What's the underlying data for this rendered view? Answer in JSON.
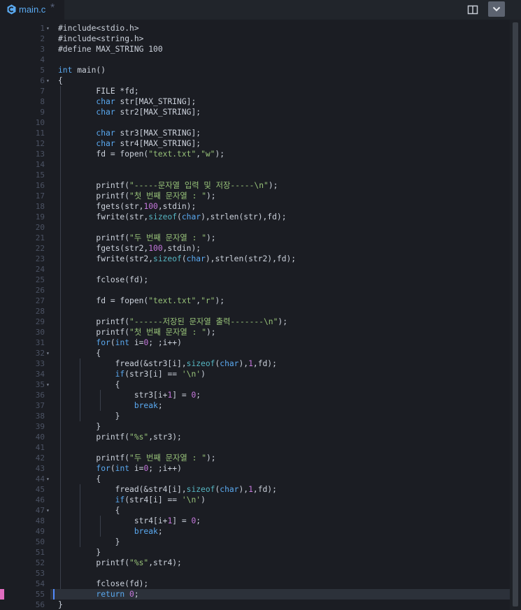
{
  "tab": {
    "filename": "main.c",
    "modified": "*",
    "icon": "c-file-icon"
  },
  "toolbar": {
    "split_icon": "split-view-icon",
    "menu_icon": "chevron-down-icon"
  },
  "editor": {
    "current_line": 55,
    "fold_lines": [
      1,
      6,
      32,
      35,
      44,
      47
    ],
    "lines": [
      [
        [
          "#include<stdio.h>",
          ""
        ]
      ],
      [
        [
          "#include<string.h>",
          ""
        ]
      ],
      [
        [
          "#define MAX_STRING 100",
          ""
        ]
      ],
      [],
      [
        [
          "int",
          "kw"
        ],
        [
          " main()",
          ""
        ]
      ],
      [
        [
          "{",
          ""
        ]
      ],
      [
        [
          "        FILE *fd;",
          ""
        ]
      ],
      [
        [
          "        ",
          ""
        ],
        [
          "char",
          "kw"
        ],
        [
          " str[MAX_STRING];",
          ""
        ]
      ],
      [
        [
          "        ",
          ""
        ],
        [
          "char",
          "kw"
        ],
        [
          " str2[MAX_STRING];",
          ""
        ]
      ],
      [],
      [
        [
          "        ",
          ""
        ],
        [
          "char",
          "kw"
        ],
        [
          " str3[MAX_STRING];",
          ""
        ]
      ],
      [
        [
          "        ",
          ""
        ],
        [
          "char",
          "kw"
        ],
        [
          " str4[MAX_STRING];",
          ""
        ]
      ],
      [
        [
          "        fd = fopen(",
          ""
        ],
        [
          "\"text.txt\"",
          "str"
        ],
        [
          ",",
          ""
        ],
        [
          "\"w\"",
          "str"
        ],
        [
          ");",
          ""
        ]
      ],
      [],
      [],
      [
        [
          "        printf(",
          ""
        ],
        [
          "\"-----문자열 입력 및 저장-----\\n\"",
          "str"
        ],
        [
          ");",
          ""
        ]
      ],
      [
        [
          "        printf(",
          ""
        ],
        [
          "\"첫 번째 문자열 : \"",
          "str"
        ],
        [
          ");",
          ""
        ]
      ],
      [
        [
          "        fgets(str,",
          ""
        ],
        [
          "100",
          "num"
        ],
        [
          ",stdin);",
          ""
        ]
      ],
      [
        [
          "        fwrite(str,",
          ""
        ],
        [
          "sizeof",
          "fn"
        ],
        [
          "(",
          ""
        ],
        [
          "char",
          "kw"
        ],
        [
          "),strlen(str),fd);",
          ""
        ]
      ],
      [],
      [
        [
          "        printf(",
          ""
        ],
        [
          "\"두 번째 문자열 : \"",
          "str"
        ],
        [
          ");",
          ""
        ]
      ],
      [
        [
          "        fgets(str2,",
          ""
        ],
        [
          "100",
          "num"
        ],
        [
          ",stdin);",
          ""
        ]
      ],
      [
        [
          "        fwrite(str2,",
          ""
        ],
        [
          "sizeof",
          "fn"
        ],
        [
          "(",
          ""
        ],
        [
          "char",
          "kw"
        ],
        [
          "),strlen(str2),fd);",
          ""
        ]
      ],
      [],
      [
        [
          "        fclose(fd);",
          ""
        ]
      ],
      [],
      [
        [
          "        fd = fopen(",
          ""
        ],
        [
          "\"text.txt\"",
          "str"
        ],
        [
          ",",
          ""
        ],
        [
          "\"r\"",
          "str"
        ],
        [
          ");",
          ""
        ]
      ],
      [],
      [
        [
          "        printf(",
          ""
        ],
        [
          "\"------저장된 문자열 출력-------\\n\"",
          "str"
        ],
        [
          ");",
          ""
        ]
      ],
      [
        [
          "        printf(",
          ""
        ],
        [
          "\"첫 번째 문자열 : \"",
          "str"
        ],
        [
          ");",
          ""
        ]
      ],
      [
        [
          "        ",
          ""
        ],
        [
          "for",
          "kw"
        ],
        [
          "(",
          ""
        ],
        [
          "int",
          "kw"
        ],
        [
          " i=",
          ""
        ],
        [
          "0",
          "num"
        ],
        [
          "; ;i++)",
          ""
        ]
      ],
      [
        [
          "        {",
          ""
        ]
      ],
      [
        [
          "            fread(&str3[i],",
          ""
        ],
        [
          "sizeof",
          "fn"
        ],
        [
          "(",
          ""
        ],
        [
          "char",
          "kw"
        ],
        [
          "),",
          ""
        ],
        [
          "1",
          "num"
        ],
        [
          ",fd);",
          ""
        ]
      ],
      [
        [
          "            ",
          ""
        ],
        [
          "if",
          "kw"
        ],
        [
          "(str3[i] == ",
          ""
        ],
        [
          "'\\n'",
          "str"
        ],
        [
          ")",
          ""
        ]
      ],
      [
        [
          "            {",
          ""
        ]
      ],
      [
        [
          "                str3[i+",
          ""
        ],
        [
          "1",
          "num"
        ],
        [
          "] = ",
          ""
        ],
        [
          "0",
          "num"
        ],
        [
          ";",
          ""
        ]
      ],
      [
        [
          "                ",
          ""
        ],
        [
          "break",
          "kw"
        ],
        [
          ";",
          ""
        ]
      ],
      [
        [
          "            }",
          ""
        ]
      ],
      [
        [
          "        }",
          ""
        ]
      ],
      [
        [
          "        printf(",
          ""
        ],
        [
          "\"%s\"",
          "str"
        ],
        [
          ",str3);",
          ""
        ]
      ],
      [],
      [
        [
          "        printf(",
          ""
        ],
        [
          "\"두 번째 문자열 : \"",
          "str"
        ],
        [
          ");",
          ""
        ]
      ],
      [
        [
          "        ",
          ""
        ],
        [
          "for",
          "kw"
        ],
        [
          "(",
          ""
        ],
        [
          "int",
          "kw"
        ],
        [
          " i=",
          ""
        ],
        [
          "0",
          "num"
        ],
        [
          "; ;i++)",
          ""
        ]
      ],
      [
        [
          "        {",
          ""
        ]
      ],
      [
        [
          "            fread(&str4[i],",
          ""
        ],
        [
          "sizeof",
          "fn"
        ],
        [
          "(",
          ""
        ],
        [
          "char",
          "kw"
        ],
        [
          "),",
          ""
        ],
        [
          "1",
          "num"
        ],
        [
          ",fd);",
          ""
        ]
      ],
      [
        [
          "            ",
          ""
        ],
        [
          "if",
          "kw"
        ],
        [
          "(str4[i] == ",
          ""
        ],
        [
          "'\\n'",
          "str"
        ],
        [
          ")",
          ""
        ]
      ],
      [
        [
          "            {",
          ""
        ]
      ],
      [
        [
          "                str4[i+",
          ""
        ],
        [
          "1",
          "num"
        ],
        [
          "] = ",
          ""
        ],
        [
          "0",
          "num"
        ],
        [
          ";",
          ""
        ]
      ],
      [
        [
          "                ",
          ""
        ],
        [
          "break",
          "kw"
        ],
        [
          ";",
          ""
        ]
      ],
      [
        [
          "            }",
          ""
        ]
      ],
      [
        [
          "        }",
          ""
        ]
      ],
      [
        [
          "        printf(",
          ""
        ],
        [
          "\"%s\"",
          "str"
        ],
        [
          ",str4);",
          ""
        ]
      ],
      [],
      [
        [
          "        fclose(fd);",
          ""
        ]
      ],
      [
        [
          "        ",
          ""
        ],
        [
          "return",
          "kw"
        ],
        [
          " ",
          ""
        ],
        [
          "0",
          "num"
        ],
        [
          ";",
          ""
        ]
      ],
      [
        [
          "}",
          ""
        ]
      ]
    ]
  }
}
